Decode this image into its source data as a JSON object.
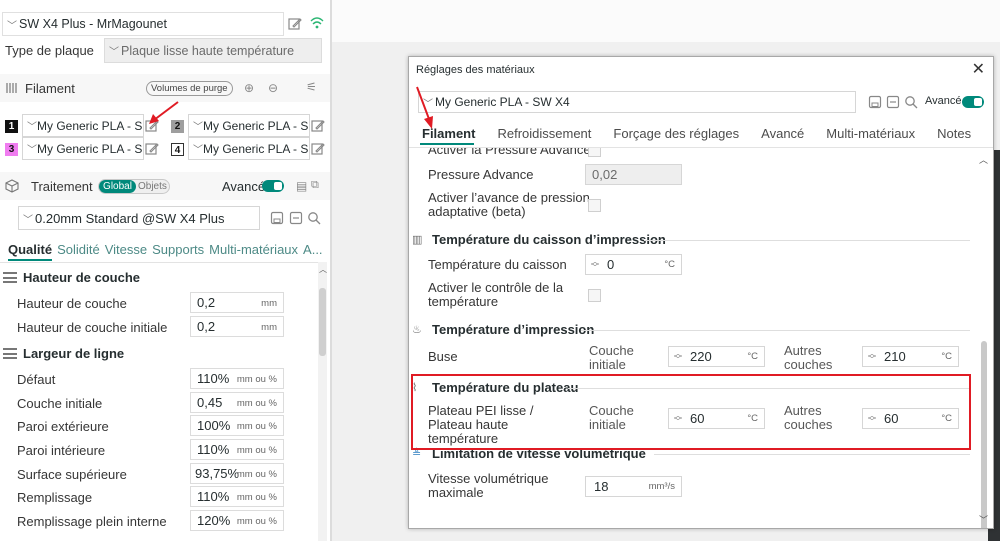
{
  "printer": {
    "name": "SW X4 Plus - MrMagounet"
  },
  "plate": {
    "label": "Type de plaque",
    "value": "Plaque lisse haute température"
  },
  "filament": {
    "title": "Filament",
    "purge_button": "Volumes de purge",
    "slots": [
      {
        "num": "1",
        "name": "My Generic PLA - S...",
        "color": "#111111",
        "text_color": "#ffffff"
      },
      {
        "num": "2",
        "name": "My Generic PLA - S...",
        "color": "#9e9e9e",
        "text_color": "#111111"
      },
      {
        "num": "3",
        "name": "My Generic PLA - S...",
        "color": "#f07cf0",
        "text_color": "#111111"
      },
      {
        "num": "4",
        "name": "My Generic PLA - S...",
        "color": "#ffffff",
        "text_color": "#111111"
      }
    ]
  },
  "process": {
    "title": "Traitement",
    "global": "Global",
    "objects": "Objets",
    "advanced": "Avancé",
    "preset": "0.20mm Standard @SW X4 Plus",
    "tabs": [
      "Qualité",
      "Solidité",
      "Vitesse",
      "Supports",
      "Multi-matériaux",
      "A..."
    ],
    "groups": [
      {
        "title": "Hauteur de couche"
      },
      {
        "title": "Largeur de ligne"
      }
    ],
    "params": [
      {
        "label": "Hauteur de couche",
        "value": "0,2",
        "unit": "mm"
      },
      {
        "label": "Hauteur de couche initiale",
        "value": "0,2",
        "unit": "mm"
      },
      {
        "label": "Défaut",
        "value": "110%",
        "unit": "mm ou %"
      },
      {
        "label": "Couche initiale",
        "value": "0,45",
        "unit": "mm ou %"
      },
      {
        "label": "Paroi extérieure",
        "value": "100%",
        "unit": "mm ou %"
      },
      {
        "label": "Paroi intérieure",
        "value": "110%",
        "unit": "mm ou %"
      },
      {
        "label": "Surface supérieure",
        "value": "93,75%",
        "unit": "mm ou %"
      },
      {
        "label": "Remplissage",
        "value": "110%",
        "unit": "mm ou %"
      },
      {
        "label": "Remplissage plein interne",
        "value": "120%",
        "unit": "mm ou %"
      }
    ]
  },
  "dialog": {
    "title": "Réglages des matériaux",
    "preset": "My Generic PLA - SW X4",
    "advanced": "Avancé",
    "tabs": [
      "Filament",
      "Refroidissement",
      "Forçage des réglages",
      "Avancé",
      "Multi-matériaux",
      "Notes"
    ],
    "pa_enable": "Activer la Pressure Advance",
    "pa_label": "Pressure Advance",
    "pa_value": "0,02",
    "adaptive_pa": "Activer l’avance de pression adaptative (beta)",
    "chamber": {
      "title": "Température du caisson d’impression",
      "temp_label": "Température du caisson",
      "temp_value": "0",
      "unit": "°C",
      "control_label": "Activer le contrôle de la température"
    },
    "print_temp": {
      "title": "Température d’impression",
      "label": "Buse",
      "first_layer_label": "Couche initiale",
      "first_layer_value": "220",
      "other_label": "Autres couches",
      "other_value": "210",
      "unit": "°C"
    },
    "bed": {
      "title": "Température du plateau",
      "label": "Plateau PEI lisse / Plateau haute température",
      "first_layer_label": "Couche initiale",
      "first_layer_value": "60",
      "other_label": "Autres couches",
      "other_value": "60",
      "unit": "°C"
    },
    "volumetric": {
      "title": "Limitation de vitesse volumétrique",
      "label": "Vitesse volumétrique maximale",
      "value": "18",
      "unit": "mm³/s"
    }
  },
  "colors": {
    "accent": "#00897b",
    "highlight": "#e01b24"
  }
}
